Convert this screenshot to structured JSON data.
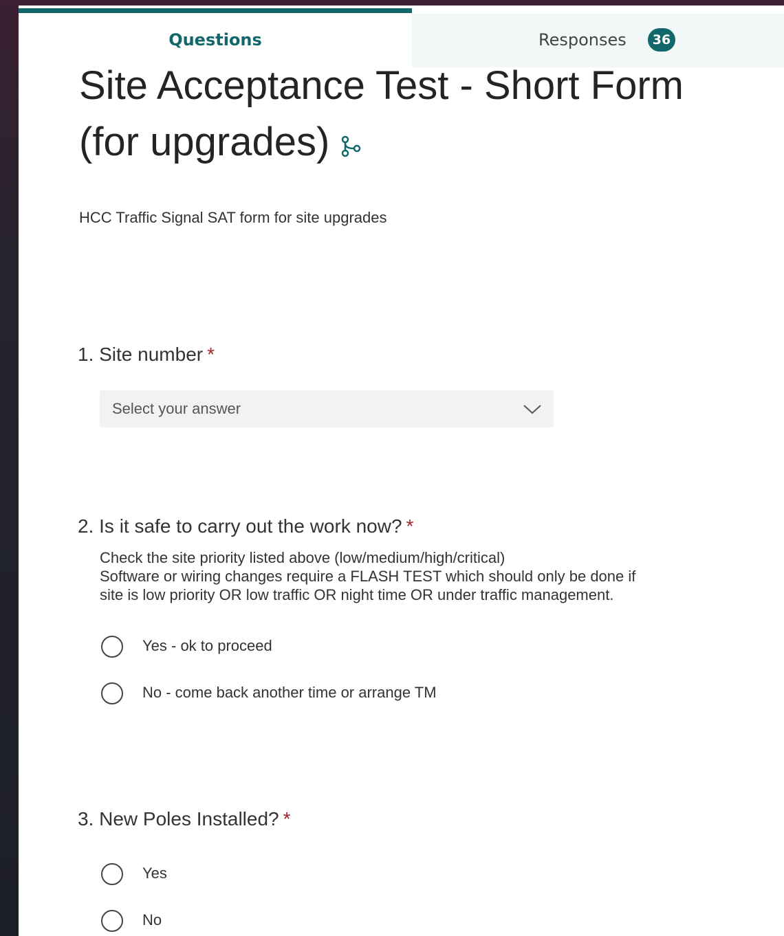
{
  "tabs": {
    "questions_label": "Questions",
    "responses_label": "Responses",
    "responses_count": "36"
  },
  "form": {
    "title": "Site Acceptance Test - Short Form (for upgrades)",
    "description": "HCC Traffic Signal SAT form for site upgrades",
    "branch_icon": "branching-icon"
  },
  "colors": {
    "accent": "#11676a",
    "required": "#a4262c"
  },
  "questions": [
    {
      "title": "1. Site number",
      "required_mark": "*",
      "dropdown_placeholder": "Select your answer"
    },
    {
      "title": "2. Is it safe to carry out the work now?",
      "required_mark": "*",
      "subtitle_lines": [
        "Check the site priority listed above (low/medium/high/critical)",
        "Software or wiring changes require a FLASH TEST which should only be done if",
        "site is low priority OR low traffic OR night time OR under traffic management."
      ],
      "options": [
        "Yes - ok to proceed",
        "No - come back another time or arrange TM"
      ]
    },
    {
      "title": "3. New Poles Installed?",
      "required_mark": "*",
      "options": [
        "Yes",
        "No"
      ]
    }
  ]
}
